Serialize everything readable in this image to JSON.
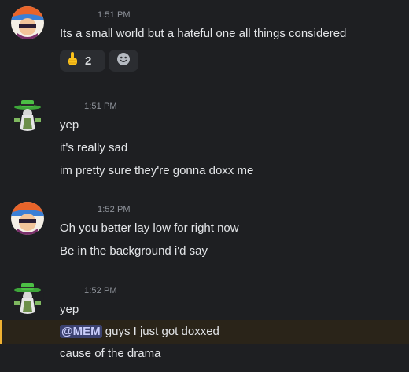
{
  "colors": {
    "background": "#1e1f22",
    "text": "#e3e5e8",
    "timestamp": "#8f939b",
    "mention_bg": "#3c4270",
    "mention_text": "#c9cdfb",
    "highlight_bg": "#2a2419",
    "highlight_bar": "#f0b232"
  },
  "messages": [
    {
      "avatar_icon": "anime-avatar-icon",
      "timestamp": "1:51 PM",
      "lines": [
        "Its a small world but a hateful one all things considered"
      ],
      "reactions": [
        {
          "icon": "pointing-up-emoji-icon",
          "count": "2"
        },
        {
          "icon": "add-reaction-icon"
        }
      ]
    },
    {
      "avatar_icon": "green-hat-avatar-icon",
      "timestamp": "1:51 PM",
      "lines": [
        "yep",
        "it's really sad",
        "im pretty sure they're gonna doxx me"
      ]
    },
    {
      "avatar_icon": "anime-avatar-icon",
      "timestamp": "1:52 PM",
      "lines": [
        "Oh you better lay low for right now",
        "Be in the background i'd say"
      ]
    },
    {
      "avatar_icon": "green-hat-avatar-icon",
      "timestamp": "1:52 PM",
      "lines": [
        "yep"
      ],
      "mention_line": {
        "mention": "@MEM",
        "text": " guys I just got doxxed"
      },
      "after_lines": [
        "cause of the drama"
      ]
    }
  ]
}
